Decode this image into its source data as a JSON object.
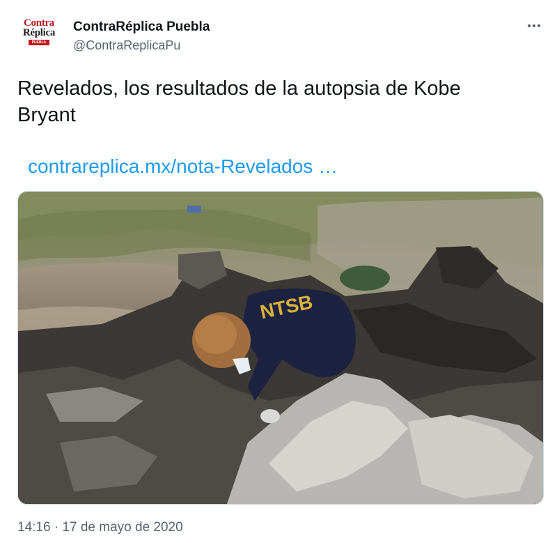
{
  "author": {
    "name": "ContraRéplica Puebla",
    "handle": "@ContraReplicaPu",
    "avatar_logo": {
      "line1": "Contra",
      "line2": "Réplica",
      "bar_text": "PUEBLA"
    }
  },
  "tweet": {
    "text": "Revelados, los resultados de la autopsia de Kobe Bryant",
    "link_text": "contrareplica.mx/nota-Revelados …",
    "image_vest_text": "NTSB",
    "timestamp": "14:16 · 17 de mayo de 2020"
  },
  "icons": {
    "more": "more-horizontal-icon"
  },
  "colors": {
    "link": "#1d9bf0",
    "secondary": "#536471",
    "text": "#0f1419",
    "logo_red": "#c4161c"
  }
}
